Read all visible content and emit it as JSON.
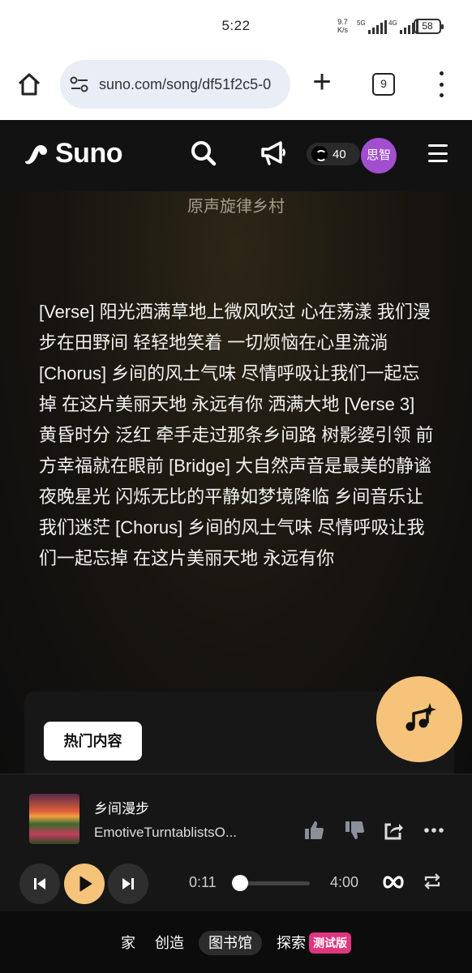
{
  "status_bar": {
    "time": "5:22",
    "net_speed_value": "9.7",
    "net_speed_unit": "K/s",
    "sim1_label": "5G",
    "sim2_label": "4G",
    "battery": "58"
  },
  "browser": {
    "url": "suno.com/song/df51f2c5-0",
    "tab_count": "9"
  },
  "header": {
    "logo_text": "Suno",
    "credits": "40",
    "avatar_text": "思智"
  },
  "song": {
    "style_title": "原声旋律乡村",
    "lyrics": "[Verse] 阳光洒满草地上微风吹过 心在荡漾 我们漫步在田野间 轻轻地笑着 一切烦恼在心里流淌 [Chorus] 乡间的风土气味 尽情呼吸让我们一起忘掉 在这片美丽天地 永远有你 洒满大地 [Verse 3] 黄昏时分 泛红 牵手走过那条乡间路 树影婆引领 前方幸福就在眼前 [Bridge] 大自然声音是最美的静谧夜晚星光 闪烁无比的平静如梦境降临 乡间音乐让我们迷茫 [Chorus] 乡间的风土气味 尽情呼吸让我们一起忘掉 在这片美丽天地 永远有你"
  },
  "card": {
    "hot_button": "热门内容"
  },
  "player": {
    "title": "乡间漫步",
    "artist": "EmotiveTurntablistsO...",
    "current_time": "0:11",
    "total_time": "4:00",
    "progress_fraction": 0.046
  },
  "bottom_nav": {
    "home": "家",
    "create": "创造",
    "library": "图书馆",
    "explore": "探索",
    "beta": "测试版"
  },
  "colors": {
    "accent_yellow": "#f6c37a",
    "avatar_purple": "#a14ecf",
    "beta_pink": "#e0357f"
  }
}
